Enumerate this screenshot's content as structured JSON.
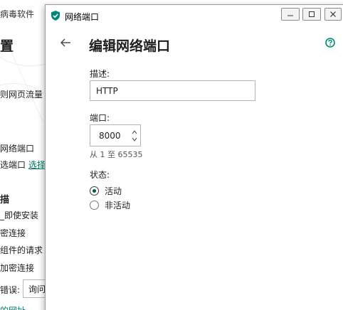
{
  "background_app": {
    "title_fragment": "病毒软件",
    "heading_fragment": "置",
    "lines": [
      "则网页流量",
      "网络端口",
      "选端口",
      "_即使安装",
      "密连接",
      "组件的请求",
      "加密连接",
      "错误:"
    ],
    "select_link": "选择",
    "section_fragment": "描",
    "select_value": "询问",
    "bottom_link": "的网址"
  },
  "dialog": {
    "window_title": "网络端口",
    "page_title": "编辑网络端口",
    "description_label": "描述:",
    "description_value": "HTTP",
    "port_label": "端口:",
    "port_value": "8000",
    "port_hint": "从 1 至 65535",
    "status_label": "状态:",
    "status_options": [
      {
        "label": "活动",
        "selected": true
      },
      {
        "label": "非活动",
        "selected": false
      }
    ]
  },
  "colors": {
    "accent": "#007a66",
    "radio_dot": "#005a4c",
    "text": "#1f1f1f"
  },
  "icons": {
    "app_icon": "shield-check-icon",
    "back": "back-arrow-icon",
    "help": "help-circle-icon",
    "minimize": "minimize-icon",
    "maximize": "maximize-icon",
    "close": "close-icon",
    "spinner": "spinner-arrows-icon"
  }
}
